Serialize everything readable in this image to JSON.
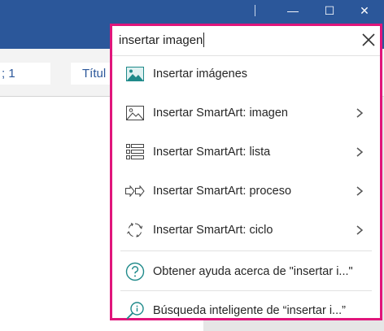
{
  "window": {
    "minimize_glyph": "—",
    "maximize_glyph": "☐",
    "close_glyph": "✕"
  },
  "ribbon": {
    "styles": [
      "; 1",
      "Títul"
    ]
  },
  "search": {
    "value": "insertar imagen"
  },
  "menu": {
    "items": [
      {
        "label": "Insertar imágenes",
        "icon": "picture-icon",
        "has_submenu": false
      },
      {
        "label": "Insertar SmartArt: imagen",
        "icon": "smartart-picture-icon",
        "has_submenu": true
      },
      {
        "label": "Insertar SmartArt: lista",
        "icon": "smartart-list-icon",
        "has_submenu": true
      },
      {
        "label": "Insertar SmartArt: proceso",
        "icon": "smartart-process-icon",
        "has_submenu": true
      },
      {
        "label": "Insertar SmartArt: ciclo",
        "icon": "smartart-cycle-icon",
        "has_submenu": true
      }
    ],
    "help_label": "Obtener ayuda acerca de \"insertar i...\"",
    "smart_lookup_label": "Búsqueda inteligente de “insertar i...”"
  },
  "colors": {
    "title_bar": "#2b579a",
    "highlight_border": "#e0157b",
    "icon_teal": "#1f8a8a"
  }
}
